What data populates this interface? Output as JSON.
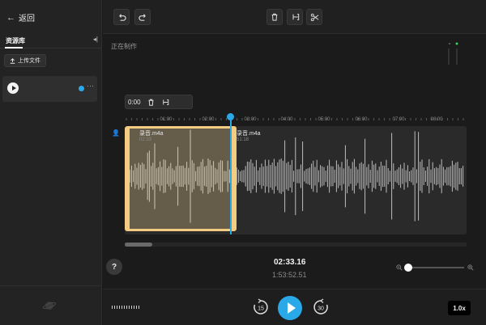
{
  "sidebar": {
    "back_label": "返回",
    "panel_title": "资源库",
    "upload_label": "上传文件",
    "back_icon": "arrow-left-icon",
    "collapse_icon": "collapse-panel-icon",
    "upload_icon": "upload-icon"
  },
  "toolbar": {
    "undo_icon": "undo-icon",
    "redo_icon": "redo-icon",
    "delete_icon": "trash-icon",
    "trim_icon": "trim-bracket-icon",
    "cut_icon": "scissors-icon"
  },
  "editor": {
    "status": "正在制作",
    "selection_time": "0:00",
    "timeline_ticks": [
      "01:00",
      "02:00",
      "03:00",
      "04:00",
      "05:00",
      "06:00",
      "07:00",
      "08:00"
    ],
    "clips": [
      {
        "name": "录音.m4a",
        "duration": "02:33"
      },
      {
        "name": "录音.m4a",
        "duration": "51:18"
      }
    ]
  },
  "playback": {
    "current_time": "02:33.16",
    "total_time": "1:53:52.51",
    "speed": "1.0x",
    "help_label": "?",
    "skip_back_seconds": "15",
    "skip_forward_seconds": "30"
  },
  "colors": {
    "accent": "#2aa9e8",
    "selection": "#f3cc82"
  }
}
